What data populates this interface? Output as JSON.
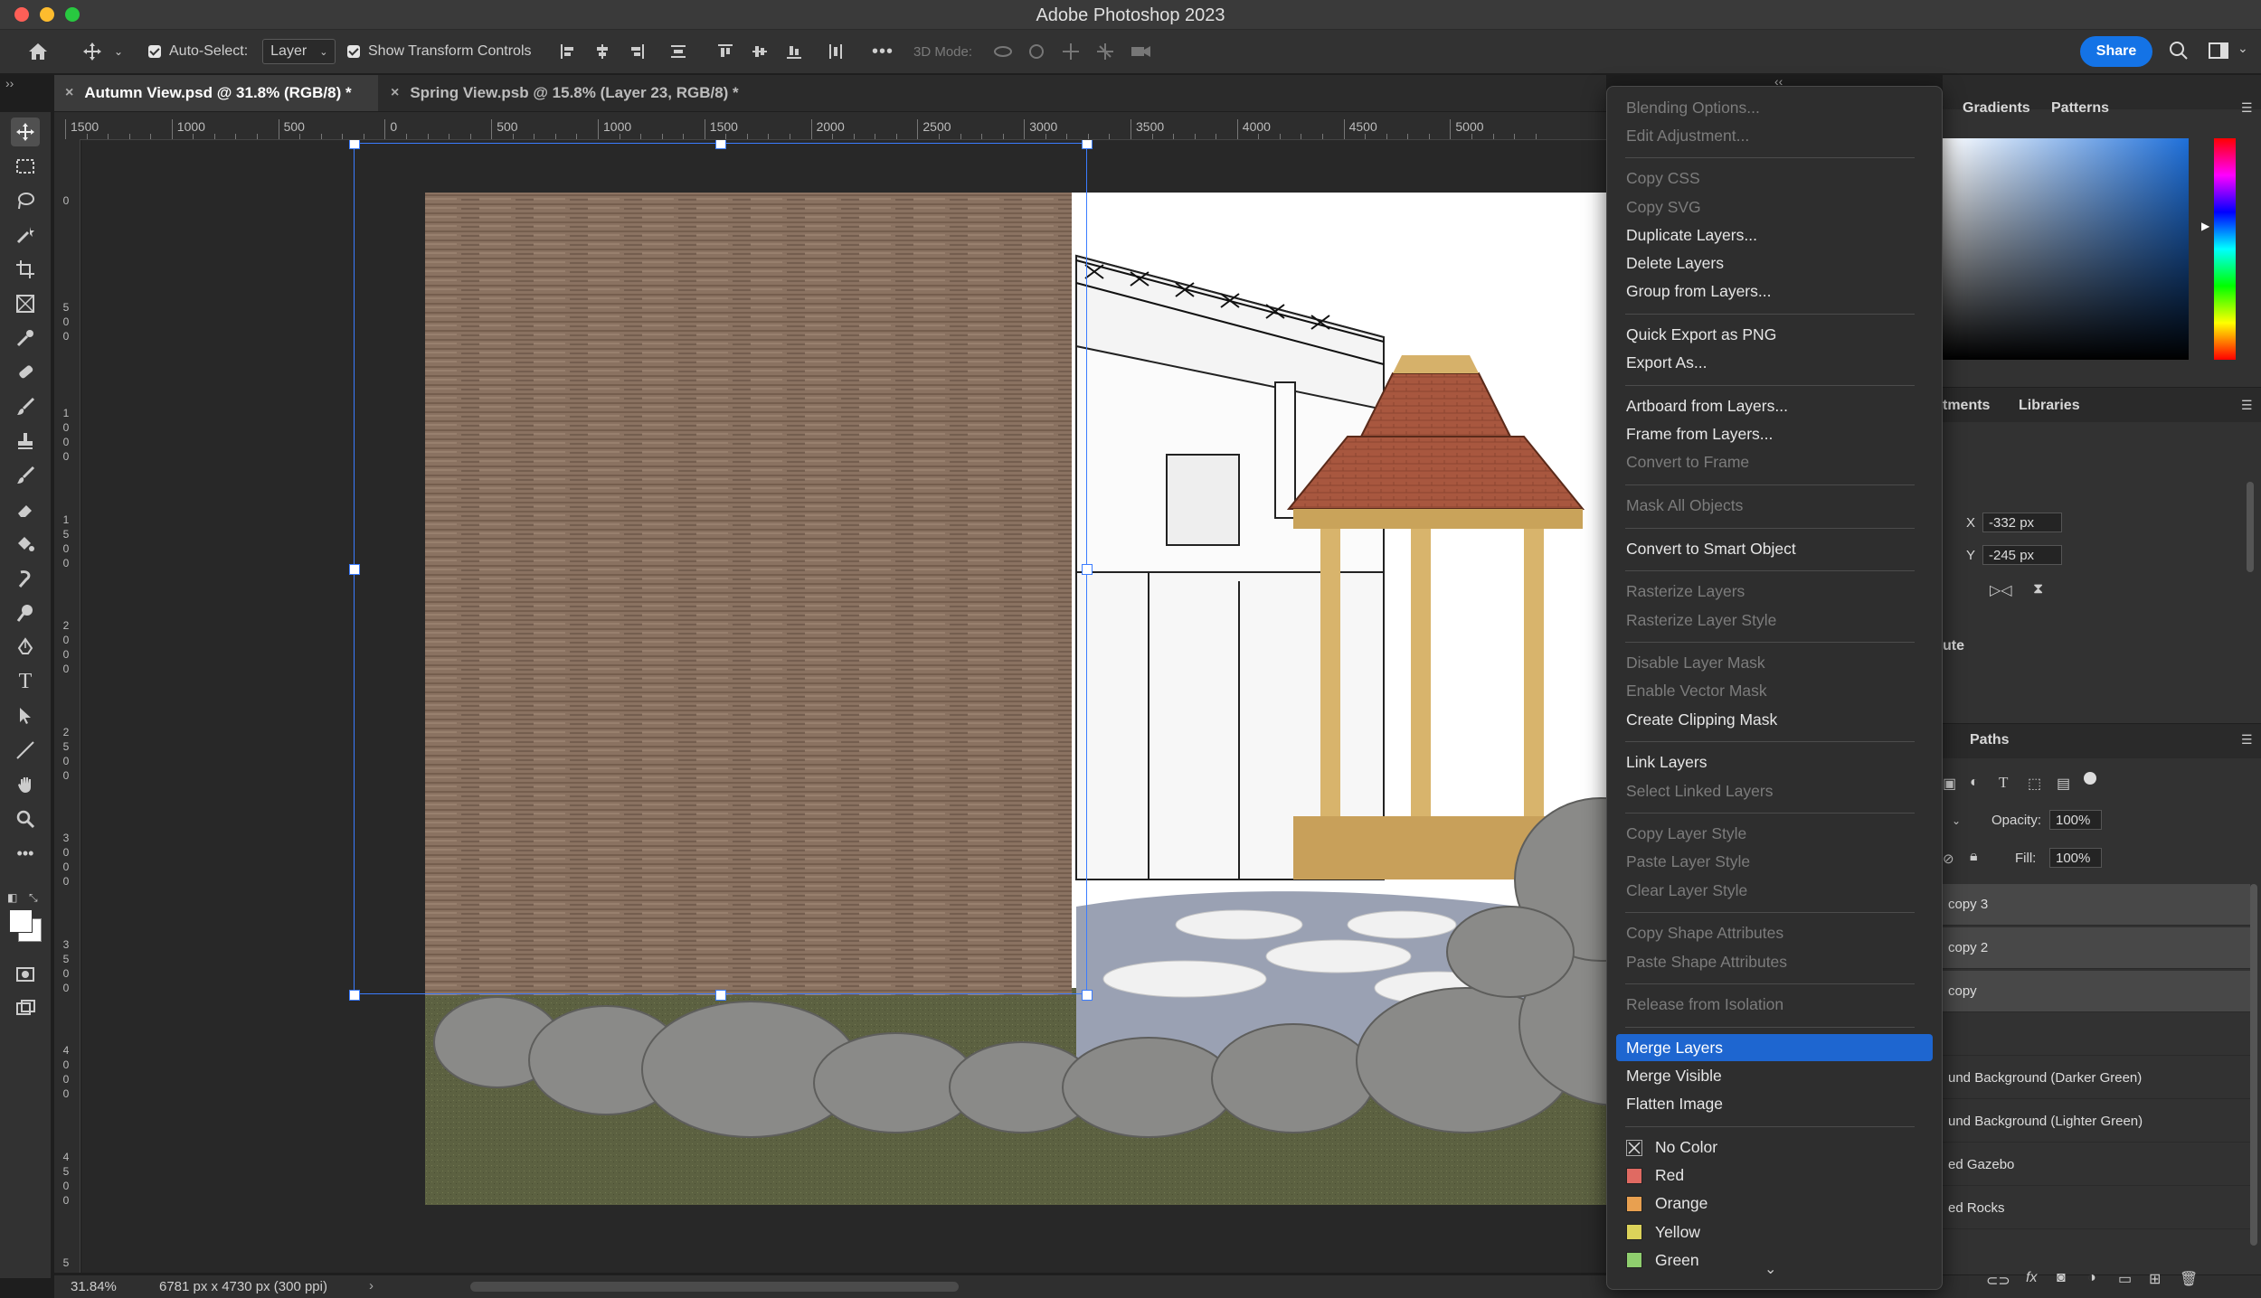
{
  "window": {
    "title": "Adobe Photoshop 2023"
  },
  "options_bar": {
    "auto_select_label": "Auto-Select:",
    "auto_select_value": "Layer",
    "show_transform_label": "Show Transform Controls",
    "mode_3d_label": "3D Mode:",
    "share_label": "Share"
  },
  "tabs": [
    {
      "label": "Autumn View.psd @ 31.8% (RGB/8) *",
      "active": true
    },
    {
      "label": "Spring View.psb @ 15.8% (Layer 23, RGB/8) *",
      "active": false
    }
  ],
  "ruler": {
    "h_labels": [
      "1500",
      "1000",
      "500",
      "0",
      "500",
      "1000",
      "1500",
      "2000",
      "2500",
      "3000",
      "3500",
      "4000",
      "4500",
      "5000"
    ],
    "v_labels": [
      "0",
      "5\n0\n0",
      "1\n0\n0\n0",
      "1\n5\n0\n0",
      "2\n0\n0\n0",
      "2\n5\n0\n0",
      "3\n0\n0\n0",
      "3\n5\n0\n0",
      "4\n0\n0\n0",
      "4\n5\n0\n0",
      "5"
    ]
  },
  "status": {
    "zoom": "31.84%",
    "doc_size": "6781 px x 4730 px (300 ppi)"
  },
  "context_menu": {
    "groups": [
      [
        {
          "label": "Blending Options...",
          "enabled": false
        },
        {
          "label": "Edit Adjustment...",
          "enabled": false
        }
      ],
      [
        {
          "label": "Copy CSS",
          "enabled": false
        },
        {
          "label": "Copy SVG",
          "enabled": false
        },
        {
          "label": "Duplicate Layers...",
          "enabled": true
        },
        {
          "label": "Delete Layers",
          "enabled": true
        },
        {
          "label": "Group from Layers...",
          "enabled": true
        }
      ],
      [
        {
          "label": "Quick Export as PNG",
          "enabled": true
        },
        {
          "label": "Export As...",
          "enabled": true
        }
      ],
      [
        {
          "label": "Artboard from Layers...",
          "enabled": true
        },
        {
          "label": "Frame from Layers...",
          "enabled": true
        },
        {
          "label": "Convert to Frame",
          "enabled": false
        }
      ],
      [
        {
          "label": "Mask All Objects",
          "enabled": false
        }
      ],
      [
        {
          "label": "Convert to Smart Object",
          "enabled": true
        }
      ],
      [
        {
          "label": "Rasterize Layers",
          "enabled": false
        },
        {
          "label": "Rasterize Layer Style",
          "enabled": false
        }
      ],
      [
        {
          "label": "Disable Layer Mask",
          "enabled": false
        },
        {
          "label": "Enable Vector Mask",
          "enabled": false
        },
        {
          "label": "Create Clipping Mask",
          "enabled": true
        }
      ],
      [
        {
          "label": "Link Layers",
          "enabled": true
        },
        {
          "label": "Select Linked Layers",
          "enabled": false
        }
      ],
      [
        {
          "label": "Copy Layer Style",
          "enabled": false
        },
        {
          "label": "Paste Layer Style",
          "enabled": false
        },
        {
          "label": "Clear Layer Style",
          "enabled": false
        }
      ],
      [
        {
          "label": "Copy Shape Attributes",
          "enabled": false
        },
        {
          "label": "Paste Shape Attributes",
          "enabled": false
        }
      ],
      [
        {
          "label": "Release from Isolation",
          "enabled": false
        }
      ],
      [
        {
          "label": "Merge Layers",
          "enabled": true,
          "selected": true
        },
        {
          "label": "Merge Visible",
          "enabled": true
        },
        {
          "label": "Flatten Image",
          "enabled": true
        }
      ]
    ],
    "colors": [
      {
        "label": "No Color",
        "swatch": "none"
      },
      {
        "label": "Red",
        "swatch": "#e06a62"
      },
      {
        "label": "Orange",
        "swatch": "#e8a050"
      },
      {
        "label": "Yellow",
        "swatch": "#dcd35a"
      },
      {
        "label": "Green",
        "swatch": "#8fce6e"
      }
    ]
  },
  "panels": {
    "color_tabs": [
      "Gradients",
      "Patterns"
    ],
    "props_tabs": [
      "tments",
      "Libraries"
    ],
    "x_label": "X",
    "x_value": "-332 px",
    "y_label": "Y",
    "y_value": "-245 px",
    "props_partial": "ute",
    "layers_tab": "Paths",
    "opacity_label": "Opacity:",
    "opacity_value": "100%",
    "fill_label": "Fill:",
    "fill_value": "100%",
    "layers": [
      {
        "name": "copy 3",
        "selected": true
      },
      {
        "name": "copy 2",
        "selected": true
      },
      {
        "name": "copy",
        "selected": true
      },
      {
        "name": "",
        "selected": false
      },
      {
        "name": "und Background (Darker Green)",
        "selected": false
      },
      {
        "name": "und Background (Lighter Green)",
        "selected": false
      },
      {
        "name": "ed Gazebo",
        "selected": false
      },
      {
        "name": "ed Rocks",
        "selected": false
      }
    ]
  }
}
